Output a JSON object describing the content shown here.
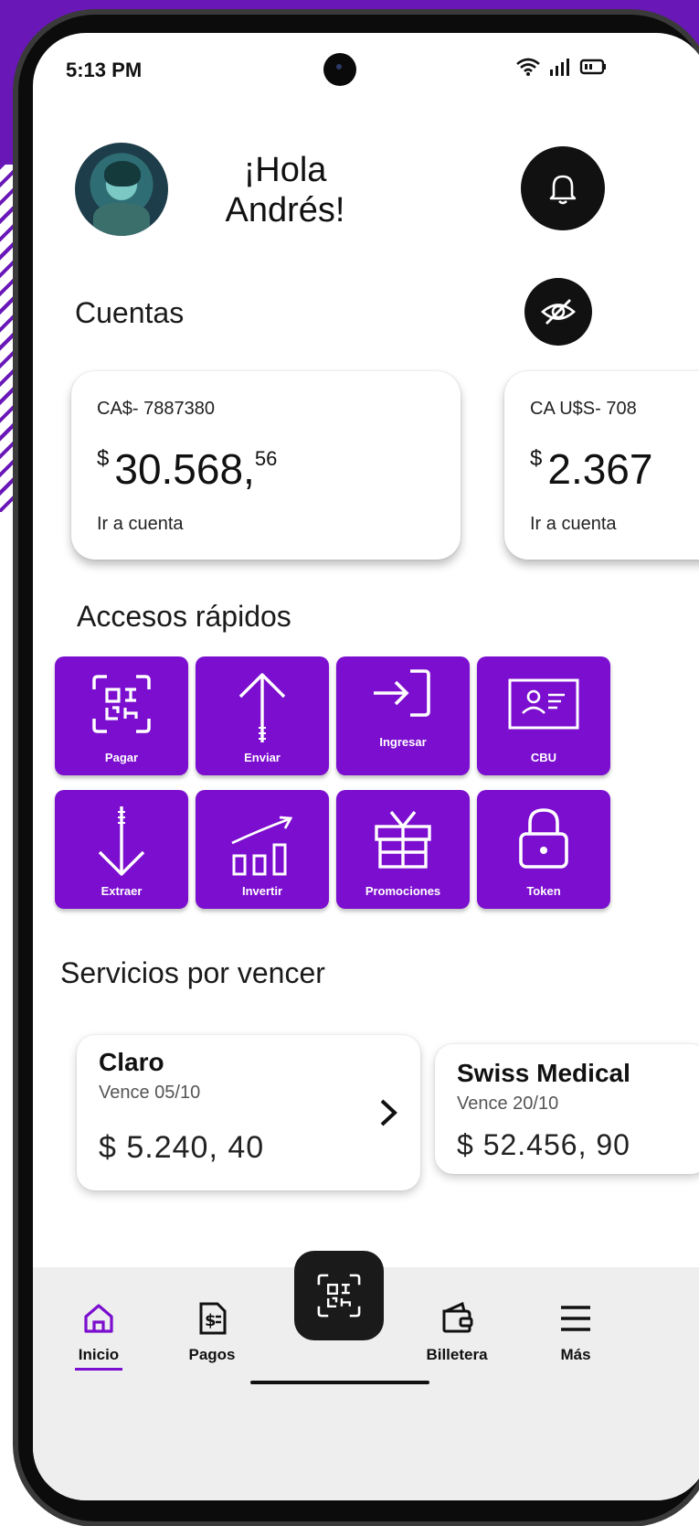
{
  "status_bar": {
    "time": "5:13 PM"
  },
  "header": {
    "greeting": "¡Hola Andrés!"
  },
  "accounts": {
    "title": "Cuentas",
    "cards": [
      {
        "id": "CA$- 7887380",
        "currency": "$",
        "amount": "30.568,",
        "cents": "56",
        "link": "Ir a cuenta"
      },
      {
        "id": "CA U$S- 708",
        "currency": "$",
        "amount": "2.367",
        "cents": "",
        "link": "Ir a cuenta"
      }
    ]
  },
  "quick_access": {
    "title": "Accesos rápidos",
    "items": [
      {
        "label": "Pagar",
        "icon": "qr-scan-icon"
      },
      {
        "label": "Enviar",
        "icon": "arrow-up-icon"
      },
      {
        "label": "Ingresar",
        "icon": "login-icon"
      },
      {
        "label": "CBU",
        "icon": "id-card-icon"
      },
      {
        "label": "Extraer",
        "icon": "arrow-down-icon"
      },
      {
        "label": "Invertir",
        "icon": "chart-growth-icon"
      },
      {
        "label": "Promociones",
        "icon": "gift-icon"
      },
      {
        "label": "Token",
        "icon": "lock-icon"
      }
    ]
  },
  "services": {
    "title": "Servicios por vencer",
    "items": [
      {
        "name": "Claro",
        "due": "Vence 05/10",
        "amount": "$ 5.240, 40"
      },
      {
        "name": "Swiss Medical",
        "due": "Vence 20/10",
        "amount": "$ 52.456, 90"
      }
    ]
  },
  "bottom_nav": {
    "items": [
      {
        "label": "Inicio",
        "icon": "home-icon",
        "active": true
      },
      {
        "label": "Pagos",
        "icon": "bill-icon"
      },
      {
        "label": "Billetera",
        "icon": "wallet-icon"
      },
      {
        "label": "Más",
        "icon": "menu-icon"
      }
    ],
    "fab_icon": "qr-scan-icon"
  },
  "colors": {
    "accent": "#7b0ecf",
    "background_purple": "#6a17b8",
    "dark": "#111111"
  }
}
